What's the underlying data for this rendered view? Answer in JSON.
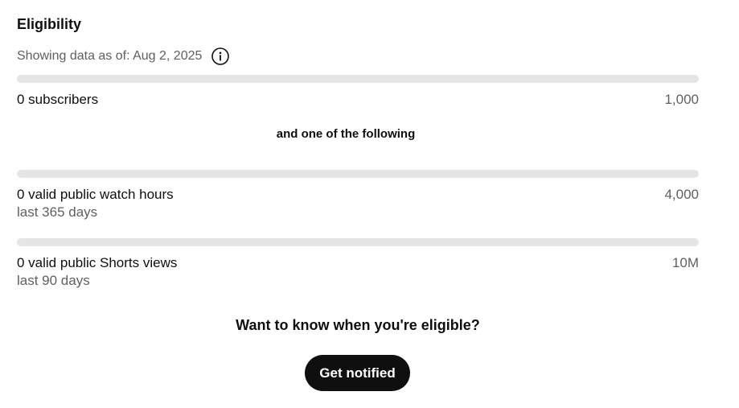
{
  "eligibility": {
    "title": "Eligibility",
    "as_of_text": "Showing data as of: Aug 2, 2025",
    "info_icon": "info-icon",
    "subscribers": {
      "label": "0 subscribers",
      "target": "1,000",
      "progress": 0
    },
    "divider_text": "and one of the following",
    "watch_hours": {
      "label": "0 valid public watch hours",
      "sub": "last 365 days",
      "target": "4,000",
      "progress": 0
    },
    "shorts_views": {
      "label": "0 valid public Shorts views",
      "sub": "last 90 days",
      "target": "10M",
      "progress": 0
    },
    "notify_prompt": "Want to know when you're eligible?",
    "notify_button": "Get notified"
  },
  "colors": {
    "track": "#e5e5e5",
    "fill": "#065fd4",
    "button_bg": "#0f0f0f",
    "secondary_text": "#606060"
  }
}
